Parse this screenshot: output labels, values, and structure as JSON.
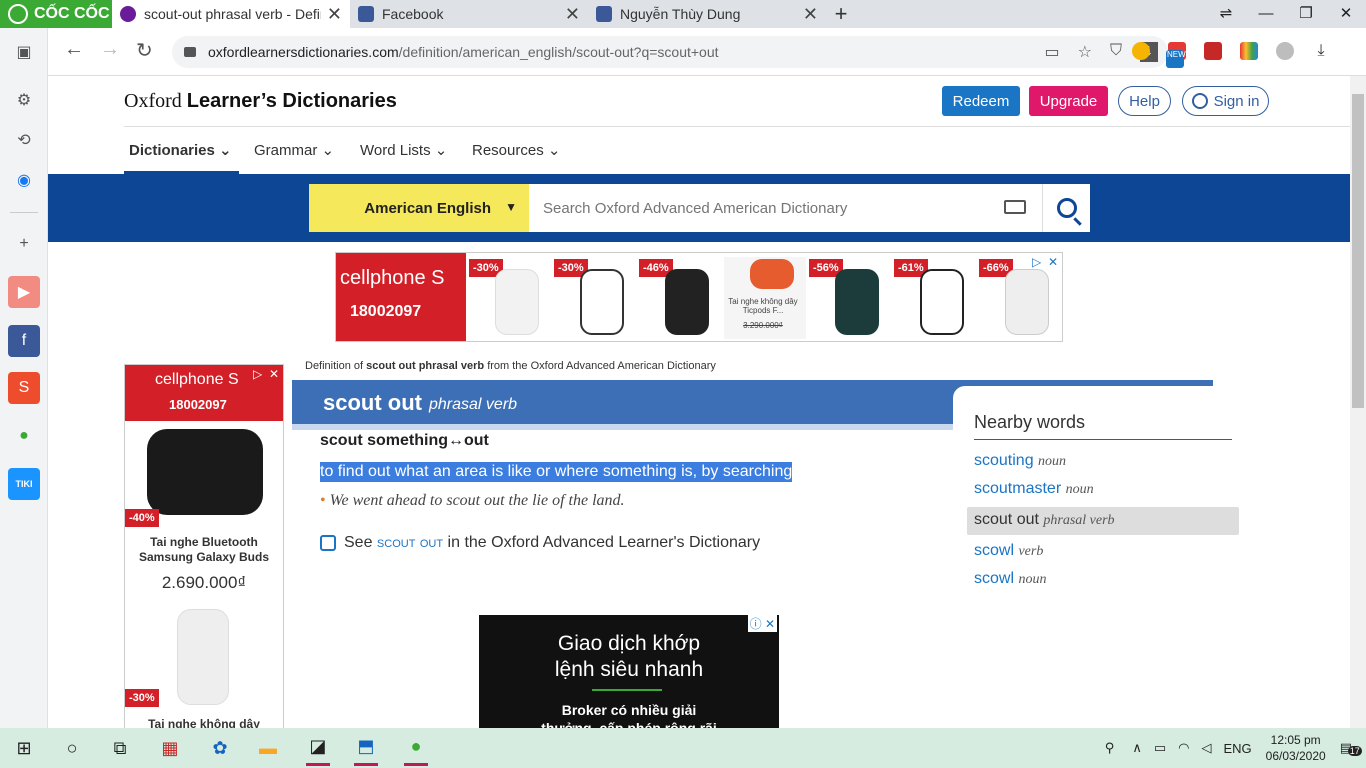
{
  "browser": {
    "brand": "CỐC CỐC",
    "tabs": [
      {
        "title": "scout-out phrasal verb - Defin",
        "color": "#6a1b9a",
        "active": true
      },
      {
        "title": "Facebook",
        "color": "#3b5998",
        "active": false
      },
      {
        "title": "Nguyễn Thùy Dung",
        "color": "#3b5998",
        "active": false
      }
    ],
    "url_host": "oxfordlearnersdictionaries.com",
    "url_path": "/definition/american_english/scout-out?q=scout+out",
    "new_badge": "NEW"
  },
  "site": {
    "logo_plain": "Oxford ",
    "logo_bold": "Learner’s Dictionaries",
    "redeem": "Redeem",
    "upgrade": "Upgrade",
    "help": "Help",
    "signin": "Sign in",
    "nav": [
      "Dictionaries",
      "Grammar",
      "Word Lists",
      "Resources"
    ],
    "dict_select": "American English",
    "search_placeholder": "Search Oxford Advanced American Dictionary"
  },
  "ad_top": {
    "brand": "cellphone S",
    "phone": "18002097",
    "discounts": [
      "-30%",
      "-30%",
      "-46%",
      "",
      "-56%",
      "-61%",
      "-66%"
    ],
    "caption": "Tai nghe không dây Ticpods F...",
    "old_price": "3.290.000₫"
  },
  "ad_left": {
    "brand": "cellphone S",
    "phone": "18002097",
    "disc1": "-40%",
    "product1": "Tai nghe Bluetooth Samsung Galaxy Buds",
    "price1": "2.690.000₫",
    "disc2": "-30%",
    "product2": "Tai nghe không dây Xiaomi"
  },
  "entry": {
    "def_of_prefix": "Definition of ",
    "def_of_bold": "scout out phrasal verb",
    "def_of_suffix": " from the Oxford Advanced American Dictionary",
    "headword": "scout out",
    "pos": "phrasal verb",
    "sense": "scout something↔out",
    "definition": "to find out what an area is like or where something is, by searching",
    "example": "We went ahead to scout out the lie of the land.",
    "see_prefix": "See ",
    "see_link": "scout out",
    "see_suffix": " in the Oxford Advanced Learner's Dictionary"
  },
  "nearby": {
    "title": "Nearby words",
    "items": [
      {
        "word": "scouting",
        "pos": "noun"
      },
      {
        "word": "scoutmaster",
        "pos": "noun"
      },
      {
        "word": "scout out",
        "pos": "phrasal verb",
        "selected": true
      },
      {
        "word": "scowl",
        "pos": "verb"
      },
      {
        "word": "scowl",
        "pos": "noun"
      }
    ]
  },
  "video_ad": {
    "headline1": "Giao dịch khớp",
    "headline2": "lệnh siêu nhanh",
    "sub1": "Broker có nhiều giải",
    "sub2": "thưởng, cấp phép rộng rãi"
  },
  "taskbar": {
    "lang": "ENG",
    "time": "12:05 pm",
    "date": "06/03/2020",
    "notif": "17"
  }
}
